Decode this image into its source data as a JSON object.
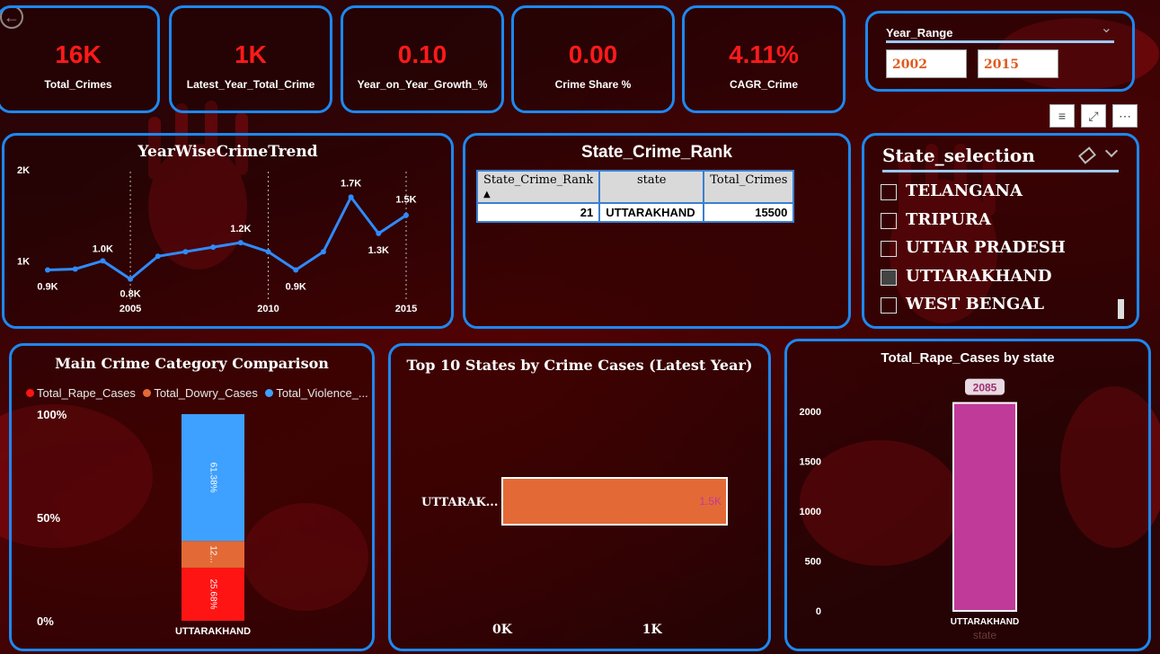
{
  "nav": {
    "back_icon": "arrow-left-icon",
    "back_glyph": "←"
  },
  "kpis": [
    {
      "value": "16K",
      "label": "Total_Crimes"
    },
    {
      "value": "1K",
      "label": "Latest_Year_Total_Crime"
    },
    {
      "value": "0.10",
      "label": "Year_on_Year_Growth_%"
    },
    {
      "value": "0.00",
      "label": "Crime Share %"
    },
    {
      "value": "4.11%",
      "label": "CAGR_Crime"
    }
  ],
  "year_range": {
    "label": "Year_Range",
    "from": "2002",
    "to": "2015",
    "chevron": "⌄"
  },
  "toolbar": {
    "filter_glyph": "≡",
    "expand_glyph": "⤢",
    "more_glyph": "⋯"
  },
  "trend": {
    "title": "YearWiseCrimeTrend",
    "y_ticks": [
      "2K",
      "1K"
    ],
    "x_ticks": [
      "2005",
      "2010",
      "2015"
    ],
    "point_labels": [
      "0.9K",
      "1.0K",
      "0.8K",
      "1.2K",
      "0.9K",
      "1.7K",
      "1.3K",
      "1.5K"
    ]
  },
  "rank": {
    "title": "State_Crime_Rank",
    "headers": [
      "State_Crime_Rank",
      "state",
      "Total_Crimes"
    ],
    "sort_glyph": "▲",
    "rows": [
      [
        "21",
        "UTTARAKHAND",
        "15500"
      ]
    ]
  },
  "state_selection": {
    "title": "State_selection",
    "items": [
      {
        "label": "TELANGANA",
        "checked": false
      },
      {
        "label": "TRIPURA",
        "checked": false
      },
      {
        "label": "UTTAR PRADESH",
        "checked": false
      },
      {
        "label": "UTTARAKHAND",
        "checked": true
      },
      {
        "label": "WEST BENGAL",
        "checked": false
      }
    ]
  },
  "category": {
    "title": "Main Crime Category Comparison",
    "legend": [
      "Total_Rape_Cases",
      "Total_Dowry_Cases",
      "Total_Violence_..."
    ],
    "y_ticks": [
      "100%",
      "50%",
      "0%"
    ],
    "segment_labels": [
      "61.38%",
      "12...",
      "25.68%"
    ],
    "category_label": "UTTARAKHAND"
  },
  "top10": {
    "title": "Top 10 States by Crime Cases (Latest Year)",
    "bar_label": "UTTARAK...",
    "value_label": "1.5K",
    "x_ticks": [
      "0K",
      "1K"
    ]
  },
  "rape": {
    "title": "Total_Rape_Cases by state",
    "y_ticks": [
      "2000",
      "1500",
      "1000",
      "500",
      "0"
    ],
    "value_label": "2085",
    "category_label": "UTTARAKHAND",
    "x_axis_label": "state"
  },
  "chart_data": [
    {
      "type": "line",
      "title": "YearWiseCrimeTrend",
      "x": [
        2002,
        2003,
        2004,
        2005,
        2006,
        2007,
        2008,
        2009,
        2010,
        2011,
        2012,
        2013,
        2014,
        2015
      ],
      "series": [
        {
          "values": [
            900,
            910,
            1000,
            800,
            1050,
            1100,
            1150,
            1200,
            1100,
            900,
            1100,
            1700,
            1300,
            1500
          ]
        }
      ],
      "ylim": [
        500,
        2000
      ],
      "grid": false
    },
    {
      "type": "bar",
      "title": "Main Crime Category Comparison",
      "categories": [
        "UTTARAKHAND"
      ],
      "stacked_percent": true,
      "series": [
        {
          "name": "Total_Rape_Cases",
          "values": [
            25.68
          ],
          "color": "#ff1414"
        },
        {
          "name": "Total_Dowry_Cases",
          "values": [
            12.94
          ],
          "color": "#e36a36"
        },
        {
          "name": "Total_Violence_...",
          "values": [
            61.38
          ],
          "color": "#3ea0ff"
        }
      ],
      "ylim": [
        0,
        100
      ]
    },
    {
      "type": "bar",
      "orientation": "horizontal",
      "title": "Top 10 States by Crime Cases (Latest Year)",
      "categories": [
        "UTTARAK..."
      ],
      "values": [
        1500
      ],
      "xlim": [
        0,
        1500
      ],
      "color": "#e36a36"
    },
    {
      "type": "bar",
      "title": "Total_Rape_Cases by state",
      "categories": [
        "UTTARAKHAND"
      ],
      "values": [
        2085
      ],
      "ylim": [
        0,
        2200
      ],
      "xlabel": "state",
      "color": "#c03a9a"
    }
  ]
}
